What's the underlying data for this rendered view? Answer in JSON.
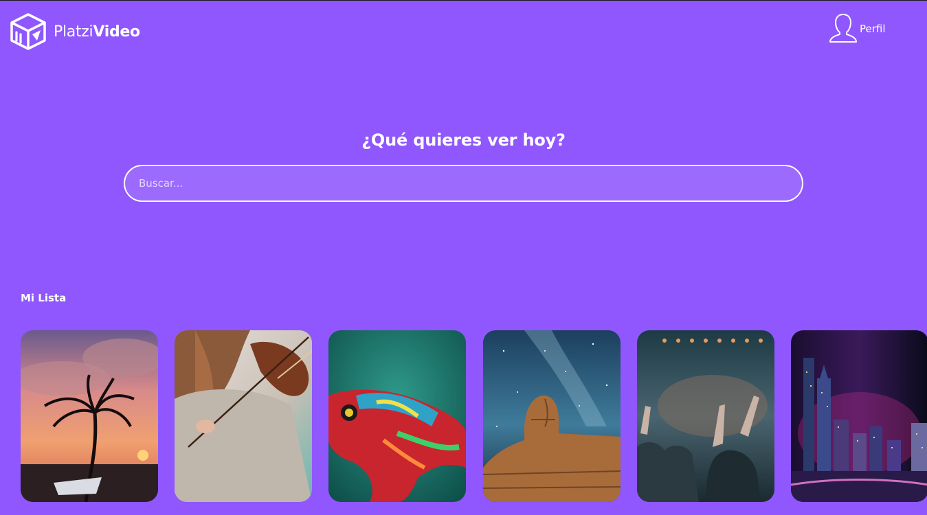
{
  "brand": {
    "name_light": "Platzi",
    "name_bold": "Video"
  },
  "header": {
    "profile_label": "Perfil"
  },
  "hero": {
    "title": "¿Qué quieres ver hoy?"
  },
  "search": {
    "placeholder": "Buscar...",
    "value": ""
  },
  "my_list": {
    "title": "Mi Lista",
    "items": [
      {
        "icon": "beach-sunset-thumbnail"
      },
      {
        "icon": "violin-player-thumbnail"
      },
      {
        "icon": "chameleon-thumbnail"
      },
      {
        "icon": "sphinx-night-sky-thumbnail"
      },
      {
        "icon": "concert-crowd-thumbnail"
      },
      {
        "icon": "city-skyline-night-thumbnail"
      }
    ]
  },
  "colors": {
    "background": "#8f57fd",
    "text": "#ffffff",
    "search_border": "#ffffff"
  }
}
